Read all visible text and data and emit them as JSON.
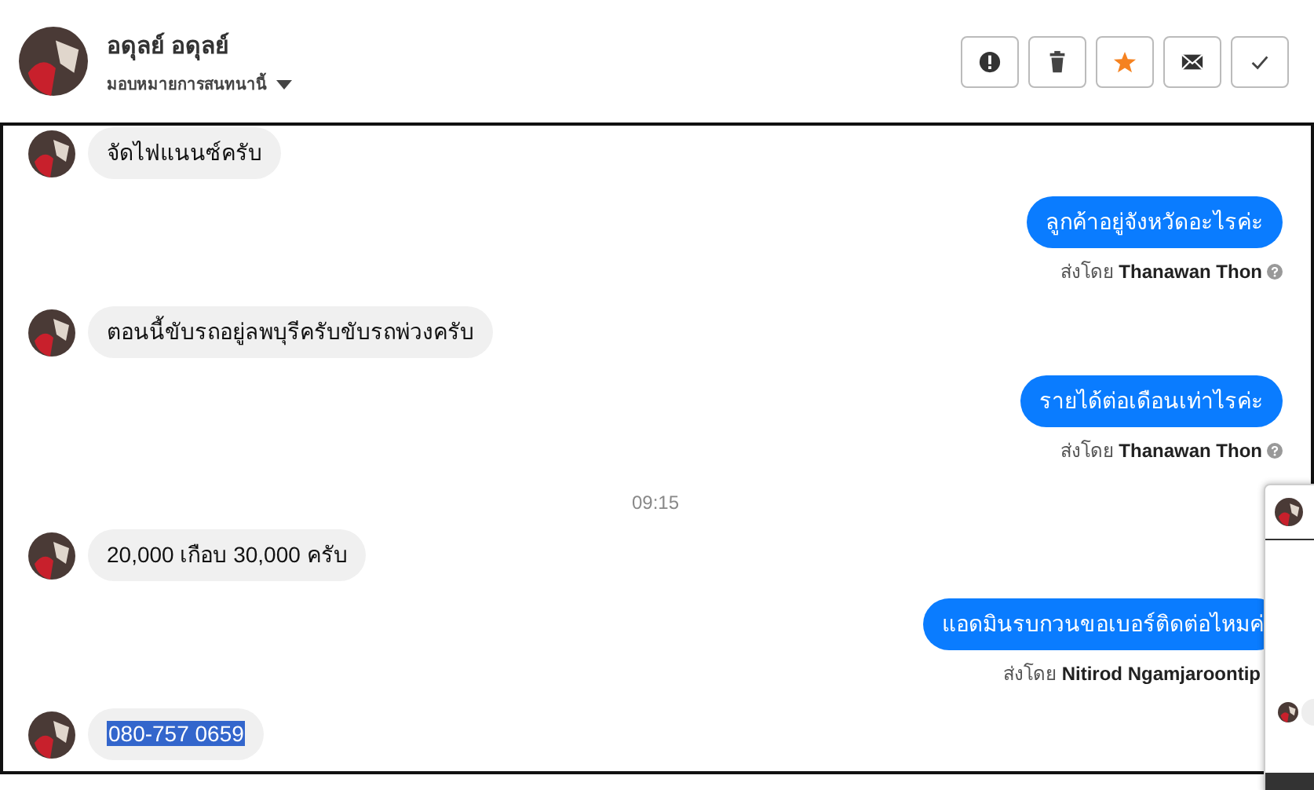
{
  "header": {
    "name": "อดุลย์ อดุลย์",
    "assign": "มอบหมายการสนทนานี้"
  },
  "buttons": [
    {
      "kind": "alert"
    },
    {
      "kind": "trash"
    },
    {
      "kind": "star",
      "active": true
    },
    {
      "kind": "mail"
    },
    {
      "kind": "check"
    }
  ],
  "messages": [
    {
      "kind": "incoming",
      "text": "จัดไฟแนนซ์ครับ",
      "selected": false
    },
    {
      "kind": "outgoing",
      "text": "ลูกค้าอยู่จังหวัดอะไรค่ะ",
      "sender": "ส่งโดย **Thanawan Thon**",
      "info": true
    },
    {
      "kind": "incoming",
      "text": "ตอนนี้ขับรถอยู่ลพบุรีครับขับรถพ่วงครับ",
      "selected": false
    },
    {
      "kind": "outgoing",
      "text": "รายได้ต่อเดือนเท่าไรค่ะ",
      "sender": "ส่งโดย **Thanawan Thon**",
      "info": true
    },
    {
      "kind": "time",
      "text": "09:15"
    },
    {
      "kind": "incoming",
      "text": "20,000 เกือบ 30,000 ครับ",
      "selected": false
    },
    {
      "kind": "outgoing",
      "text": "แอดมินรบกวนขอเบอร์ติดต่อไหมค่",
      "sender": "ส่งโดย **Nitirod Ngamjaroontip**",
      "info": false
    },
    {
      "kind": "incoming",
      "text": "080-757 0659",
      "selected": true
    }
  ]
}
